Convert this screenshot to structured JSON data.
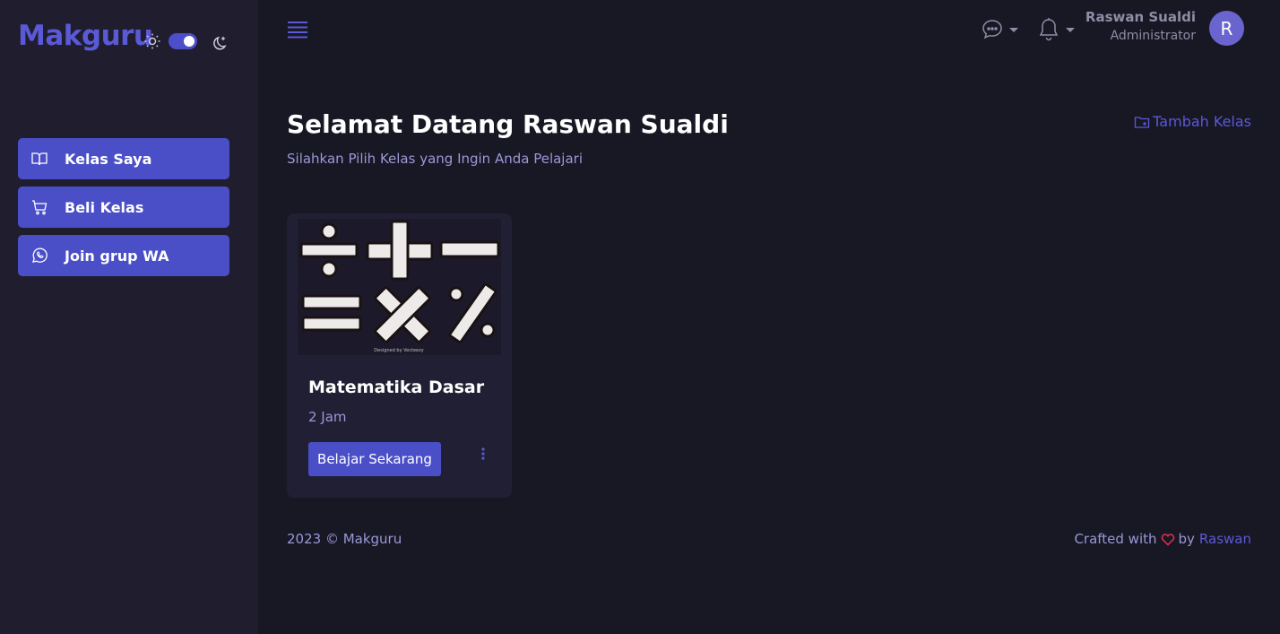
{
  "brand": {
    "name": "Makguru"
  },
  "theme": {
    "mode": "dark",
    "accent": "#4a4fc7"
  },
  "sidebar": {
    "items": [
      {
        "label": "Kelas Saya",
        "icon": "book-open-icon"
      },
      {
        "label": "Beli Kelas",
        "icon": "shopping-cart-icon"
      },
      {
        "label": "Join grup WA",
        "icon": "whatsapp-icon"
      }
    ]
  },
  "topbar": {
    "user": {
      "name": "Raswan Sualdi",
      "role": "Administrator",
      "initial": "R"
    }
  },
  "main": {
    "title": "Selamat Datang Raswan Sualdi",
    "subtitle": "Silahkan Pilih Kelas yang Ingin Anda Pelajari",
    "add_class_label": "Tambah Kelas",
    "courses": [
      {
        "title": "Matematika Dasar",
        "duration": "2 Jam",
        "button_label": "Belajar Sekarang",
        "image_credit": "Designed by Vecteezy"
      }
    ]
  },
  "footer": {
    "copyright": "2023 © Makguru",
    "crafted_prefix": "Crafted with",
    "crafted_by": "by",
    "author": "Raswan"
  }
}
